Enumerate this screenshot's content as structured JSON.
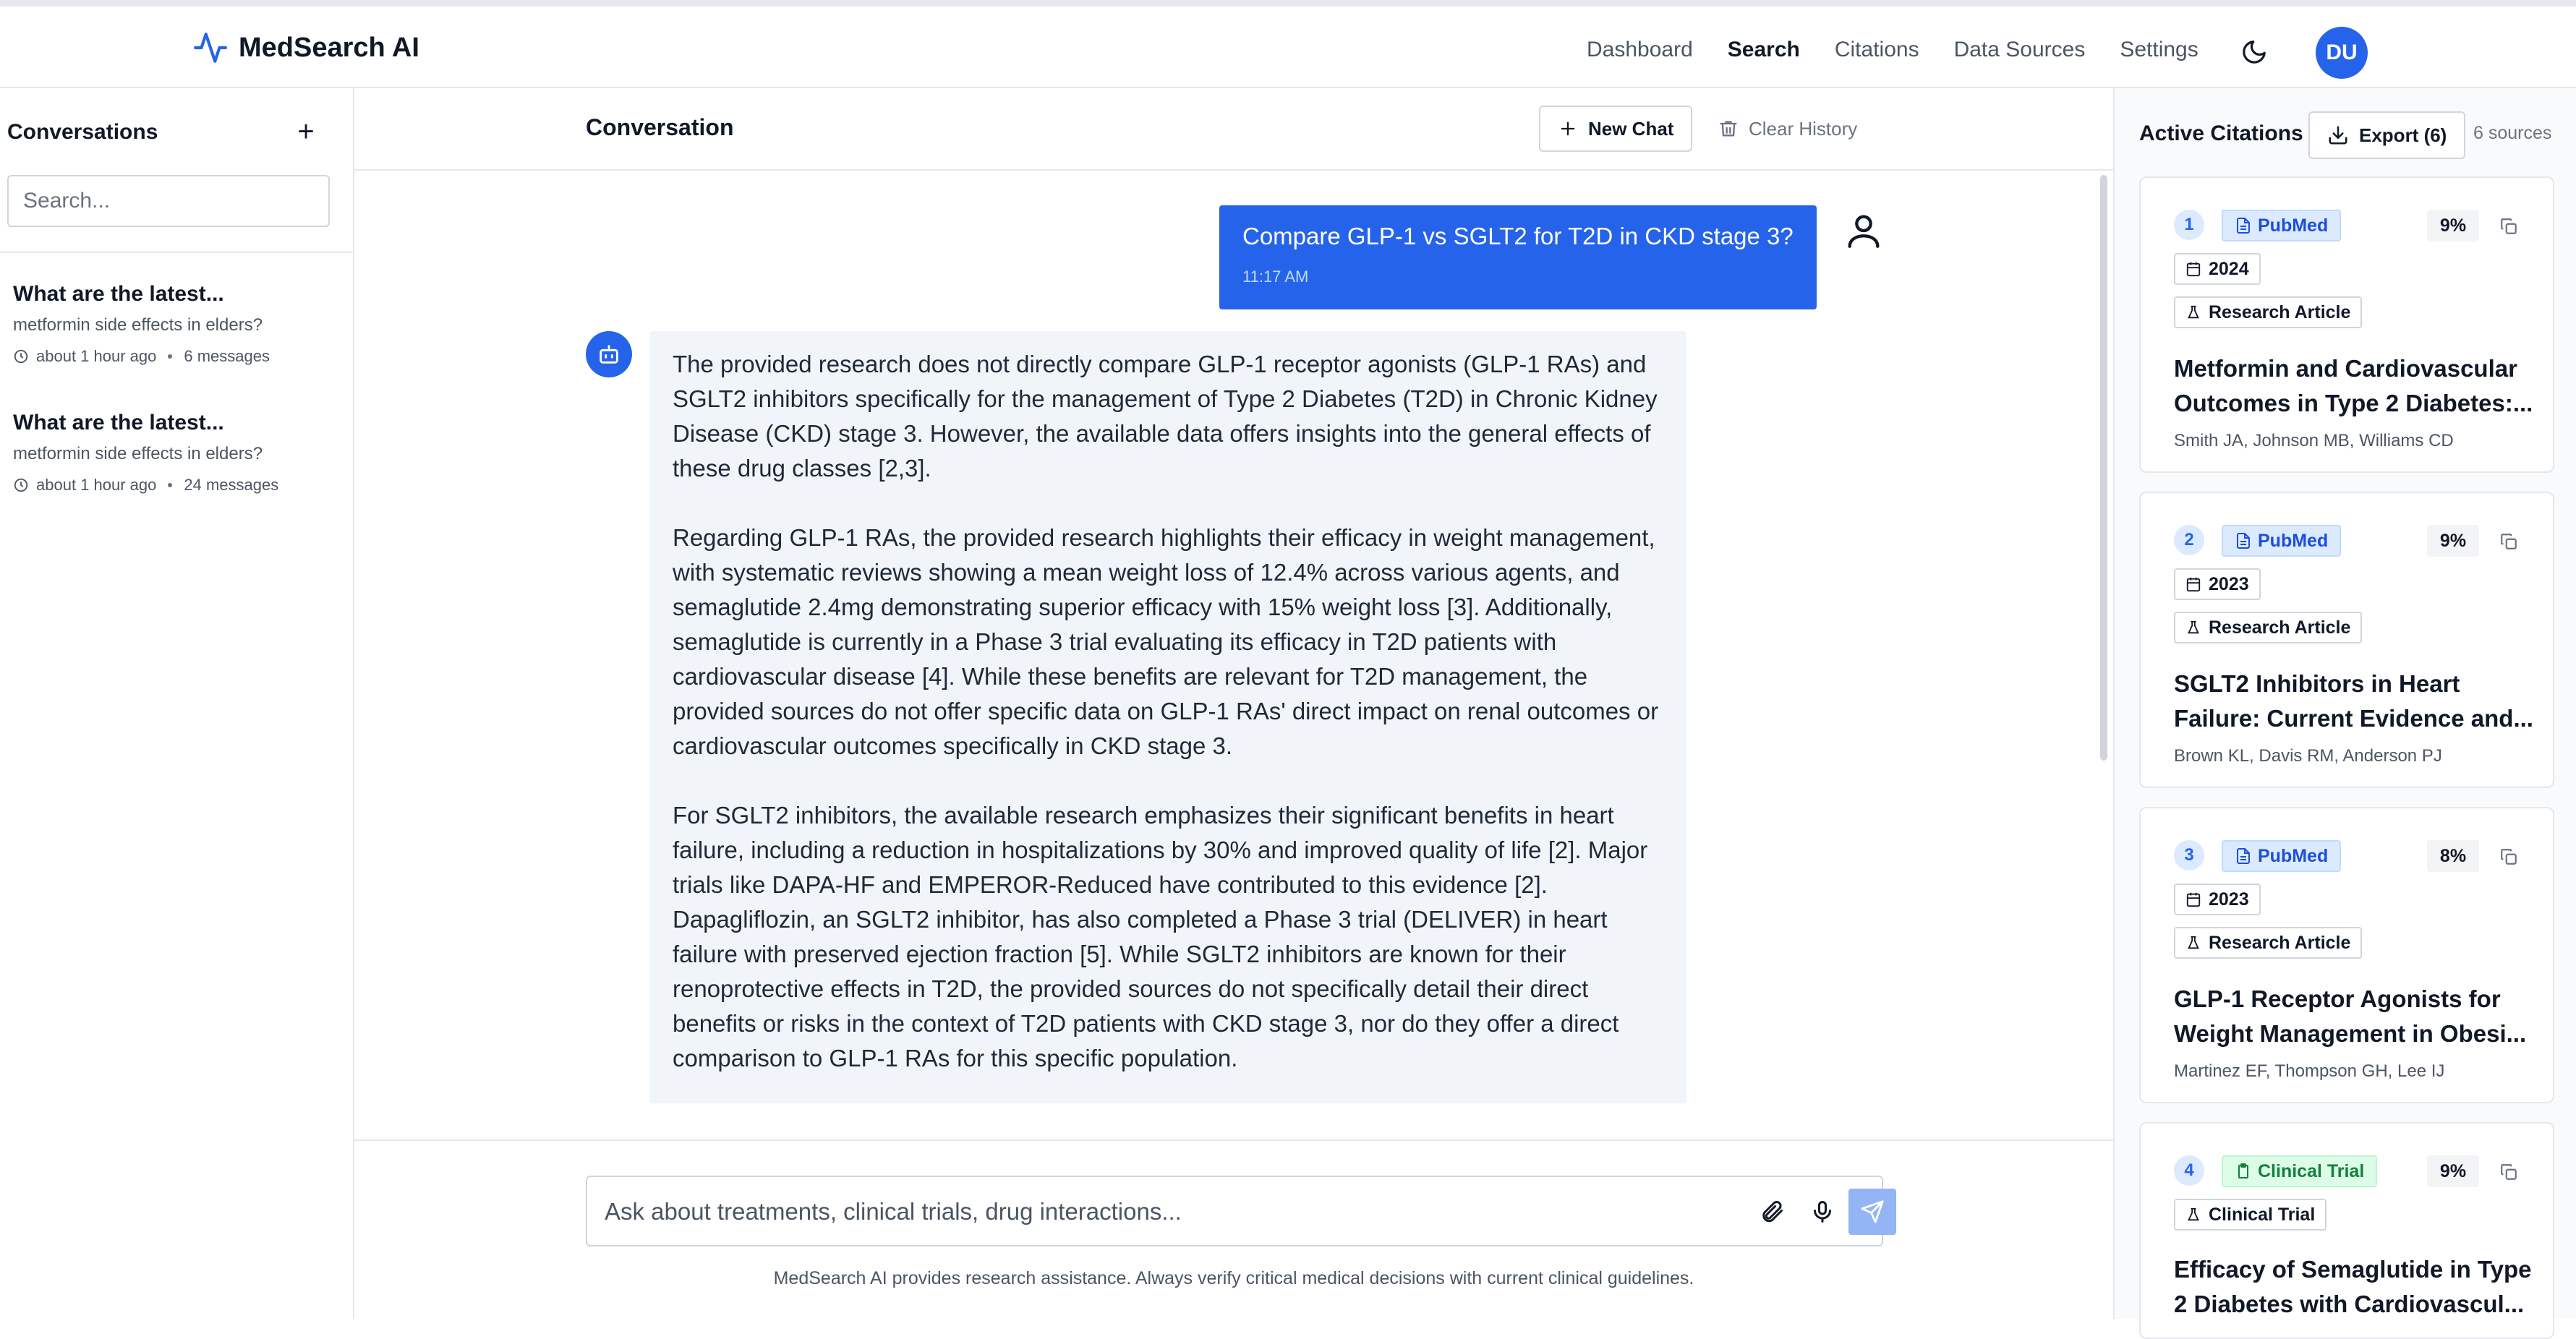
{
  "header": {
    "brand": "MedSearch AI",
    "nav": [
      "Dashboard",
      "Search",
      "Citations",
      "Data Sources",
      "Settings"
    ],
    "active_nav": "Search",
    "avatar_initials": "DU",
    "brand_color": "#2563eb"
  },
  "sidebar": {
    "title": "Conversations",
    "search_placeholder": "Search...",
    "conversations": [
      {
        "title": "What are the latest...",
        "subtitle": "metformin side effects in elders?",
        "time": "about 1 hour ago",
        "count": "6 messages"
      },
      {
        "title": "What are the latest...",
        "subtitle": "metformin side effects in elders?",
        "time": "about 1 hour ago",
        "count": "24 messages"
      }
    ]
  },
  "main": {
    "title": "Conversation",
    "new_chat_label": "New Chat",
    "clear_history_label": "Clear History",
    "user_message": {
      "text": "Compare GLP-1 vs SGLT2 for T2D in CKD stage 3?",
      "time": "11:17 AM"
    },
    "assistant_paragraphs": [
      "The provided research does not directly compare GLP-1 receptor agonists (GLP-1 RAs) and SGLT2 inhibitors specifically for the management of Type 2 Diabetes (T2D) in Chronic Kidney Disease (CKD) stage 3. However, the available data offers insights into the general effects of these drug classes [2,3].",
      "Regarding GLP-1 RAs, the provided research highlights their efficacy in weight management, with systematic reviews showing a mean weight loss of 12.4% across various agents, and semaglutide 2.4mg demonstrating superior efficacy with 15% weight loss [3]. Additionally, semaglutide is currently in a Phase 3 trial evaluating its efficacy in T2D patients with cardiovascular disease [4]. While these benefits are relevant for T2D management, the provided sources do not offer specific data on GLP-1 RAs' direct impact on renal outcomes or cardiovascular outcomes specifically in CKD stage 3.",
      "For SGLT2 inhibitors, the available research emphasizes their significant benefits in heart failure, including a reduction in hospitalizations by 30% and improved quality of life [2]. Major trials like DAPA-HF and EMPEROR-Reduced have contributed to this evidence [2]. Dapagliflozin, an SGLT2 inhibitor, has also completed a Phase 3 trial (DELIVER) in heart failure with preserved ejection fraction [5]. While SGLT2 inhibitors are known for their renoprotective effects in T2D, the provided sources do not specifically detail their direct benefits or risks in the context of T2D patients with CKD stage 3, nor do they offer a direct comparison to GLP-1 RAs for this specific population."
    ],
    "composer_placeholder": "Ask about treatments, clinical trials, drug interactions...",
    "disclaimer": "MedSearch AI provides research assistance. Always verify critical medical decisions with current clinical guidelines."
  },
  "citations": {
    "title": "Active Citations",
    "export_label": "Export (6)",
    "count_label": "6 sources",
    "cards": [
      {
        "num": "1",
        "source": "PubMed",
        "pct": "9%",
        "year": "2024",
        "type": "Research Article",
        "title_lines": [
          "Metformin and Cardiovascular",
          "Outcomes in Type 2 Diabetes:..."
        ],
        "authors": "Smith JA, Johnson MB, Williams CD"
      },
      {
        "num": "2",
        "source": "PubMed",
        "pct": "9%",
        "year": "2023",
        "type": "Research Article",
        "title_lines": [
          "SGLT2 Inhibitors in Heart",
          "Failure: Current Evidence and..."
        ],
        "authors": "Brown KL, Davis RM, Anderson PJ"
      },
      {
        "num": "3",
        "source": "PubMed",
        "pct": "8%",
        "year": "2023",
        "type": "Research Article",
        "title_lines": [
          "GLP-1 Receptor Agonists for",
          "Weight Management in Obesi..."
        ],
        "authors": "Martinez EF, Thompson GH, Lee IJ"
      },
      {
        "num": "4",
        "source": "Clinical Trial",
        "pct": "9%",
        "type": "Clinical Trial",
        "title_lines": [
          "Efficacy of Semaglutide in Type",
          "2 Diabetes with Cardiovascul..."
        ]
      }
    ]
  }
}
